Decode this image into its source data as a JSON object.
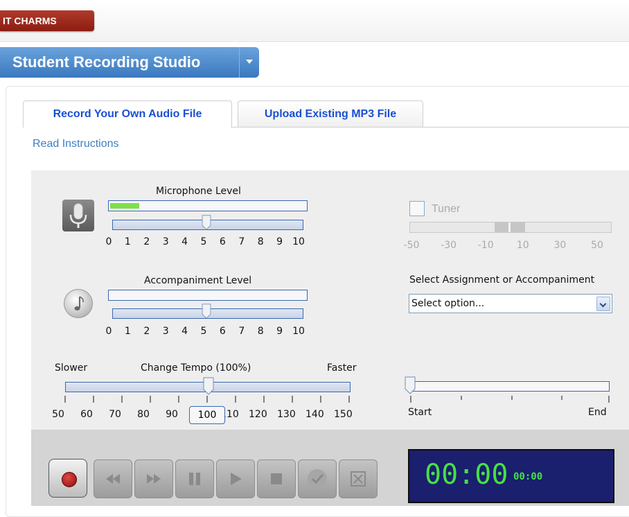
{
  "topbar": {
    "exit_label": "IT CHARMS"
  },
  "studio": {
    "title": "Student Recording Studio"
  },
  "tabs": [
    {
      "label": "Record Your Own Audio File",
      "active": true
    },
    {
      "label": "Upload Existing MP3 File",
      "active": false
    }
  ],
  "read_instructions": "Read Instructions",
  "microphone": {
    "label": "Microphone Level",
    "meter_fraction": 0.15,
    "slider_value": 5,
    "ticks": [
      "0",
      "1",
      "2",
      "3",
      "4",
      "5",
      "6",
      "7",
      "8",
      "9",
      "10"
    ]
  },
  "accompaniment": {
    "label": "Accompaniment Level",
    "meter_fraction": 0,
    "slider_value": 5,
    "ticks": [
      "0",
      "1",
      "2",
      "3",
      "4",
      "5",
      "6",
      "7",
      "8",
      "9",
      "10"
    ]
  },
  "tuner": {
    "label": "Tuner",
    "checked": false,
    "ticks": [
      "-50",
      "-30",
      "-10",
      "10",
      "30",
      "50"
    ]
  },
  "assignment": {
    "label": "Select Assignment or Accompaniment",
    "selected": "Select option..."
  },
  "tempo": {
    "slower": "Slower",
    "label": "Change Tempo (100%)",
    "faster": "Faster",
    "value": "100",
    "ticks": [
      "50",
      "60",
      "70",
      "80",
      "90",
      "100",
      "110",
      "120",
      "130",
      "140",
      "150"
    ]
  },
  "position": {
    "start": "Start",
    "end": "End",
    "fraction": 0
  },
  "transport": {
    "buttons": [
      "record-icon",
      "rewind-icon",
      "fast-forward-icon",
      "pause-icon",
      "play-icon",
      "stop-icon",
      "check-icon",
      "close-box-icon"
    ]
  },
  "timer": {
    "main": "00:00",
    "small": "00:00"
  },
  "colors": {
    "accent": "#3a78bf",
    "meter_green": "#7ee04a",
    "timer_bg": "#1a1f6e",
    "timer_text": "#47e047"
  }
}
